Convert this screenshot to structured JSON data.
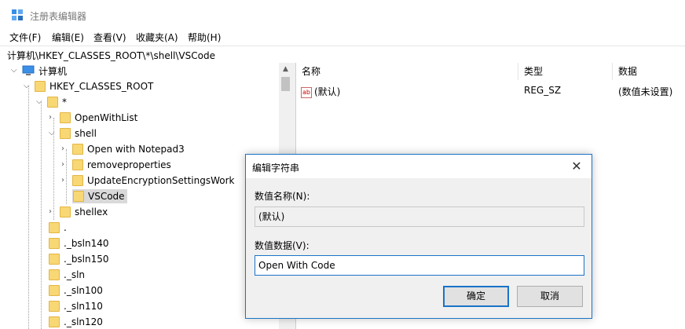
{
  "window": {
    "title": "注册表编辑器"
  },
  "menu": [
    "文件(F)",
    "编辑(E)",
    "查看(V)",
    "收藏夹(A)",
    "帮助(H)"
  ],
  "address": "计算机\\HKEY_CLASSES_ROOT\\*\\shell\\VSCode",
  "tree": {
    "root": "计算机",
    "hkcr": "HKEY_CLASSES_ROOT",
    "star": "*",
    "openwithlist": "OpenWithList",
    "shell": "shell",
    "shell_children": [
      "Open with Notepad3",
      "removeproperties",
      "UpdateEncryptionSettingsWork",
      "VSCode"
    ],
    "shellex": "shellex",
    "more": [
      ".",
      "._bsln140",
      "._bsln150",
      "._sln",
      "._sln100",
      "._sln110",
      "._sln120"
    ]
  },
  "list": {
    "headers": {
      "name": "名称",
      "type": "类型",
      "data": "数据"
    },
    "rows": [
      {
        "name": "(默认)",
        "type": "REG_SZ",
        "data": "(数值未设置)",
        "icon": "string-value-icon"
      }
    ]
  },
  "dialog": {
    "title": "编辑字符串",
    "value_name_label": "数值名称(N):",
    "value_name": "(默认)",
    "value_data_label": "数值数据(V):",
    "value_data": "Open With Code",
    "ok": "确定",
    "cancel": "取消"
  },
  "colors": {
    "accent": "#1a73c8",
    "folder": "#f8d775",
    "selection": "#d9d9d9"
  }
}
